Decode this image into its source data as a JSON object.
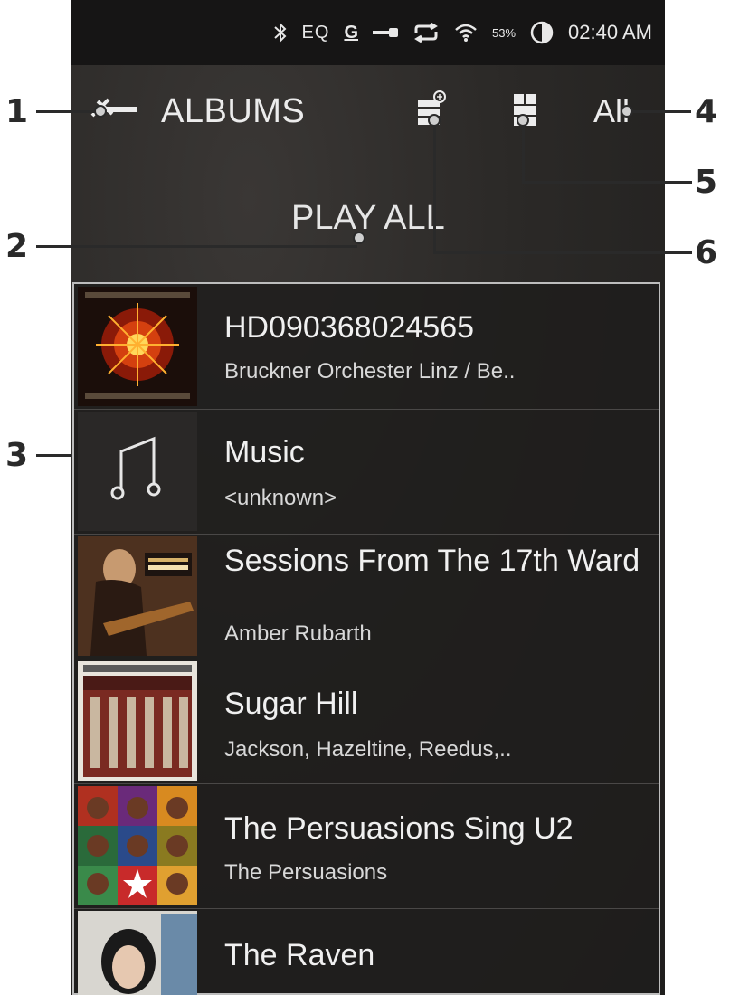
{
  "callouts": [
    "1",
    "2",
    "3",
    "4",
    "5",
    "6"
  ],
  "status_bar": {
    "bluetooth_icon": "bluetooth-icon",
    "eq": "EQ",
    "gain": "G",
    "battery_percent": "53%",
    "time": "02:40 AM"
  },
  "header": {
    "title": "ALBUMS",
    "sort": "All",
    "play_all": "PLAY ALL"
  },
  "albums": [
    {
      "title": "HD090368024565",
      "artist": "Bruckner Orchester Linz / Be.."
    },
    {
      "title": "Music",
      "artist": "<unknown>"
    },
    {
      "title": "Sessions From The 17th Ward",
      "artist": "Amber Rubarth"
    },
    {
      "title": "Sugar Hill",
      "artist": "Jackson, Hazeltine, Reedus,.."
    },
    {
      "title": "The Persuasions Sing U2",
      "artist": "The Persuasions"
    },
    {
      "title": "The Raven",
      "artist": ""
    }
  ],
  "colors": {
    "status_bg": "#161515",
    "screen_bg": "#2b2927",
    "text": "#f0f0f0",
    "border": "#bdbdbd"
  }
}
